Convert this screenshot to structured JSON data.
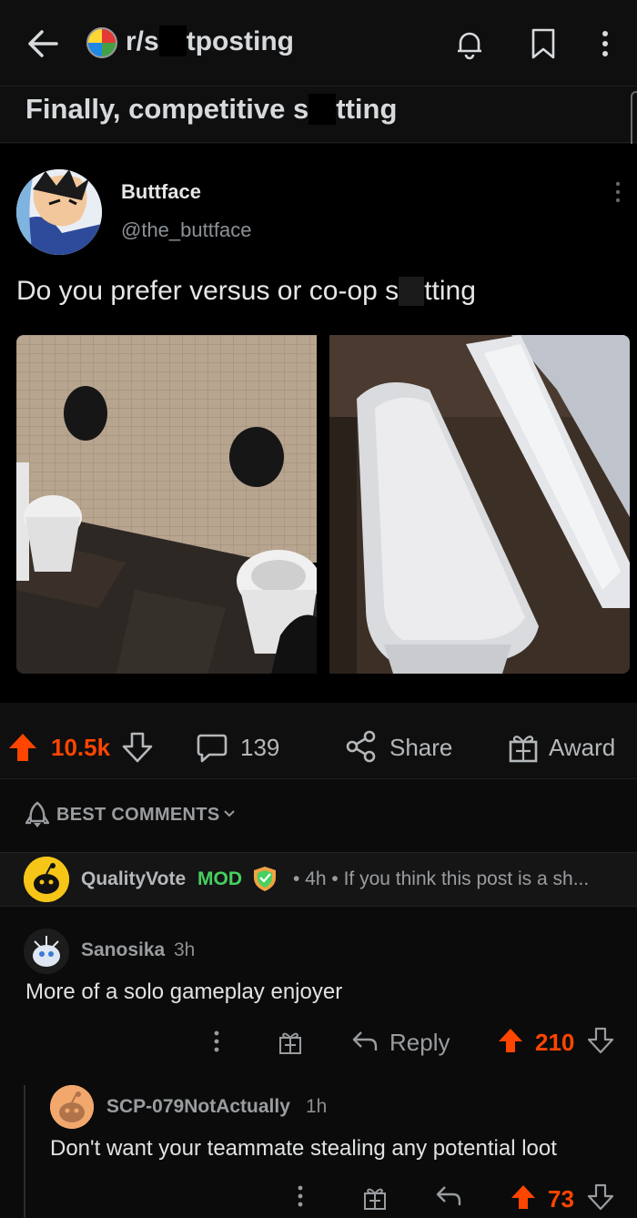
{
  "header": {
    "subreddit_prefix": "r/s",
    "subreddit_suffix": "tposting",
    "icons": [
      "back-arrow-icon",
      "subreddit-avatar",
      "bell-icon",
      "bookmark-icon",
      "kebab-menu-icon"
    ]
  },
  "post": {
    "title_prefix": "Finally, competitive s",
    "title_suffix": "tting"
  },
  "tweet": {
    "name": "Buttface",
    "handle": "@the_buttface",
    "text_prefix": "Do you prefer versus or co-op s",
    "text_suffix": "tting"
  },
  "actions": {
    "votes": "10.5k",
    "comments": "139",
    "share": "Share",
    "award": "Award"
  },
  "sort": {
    "label": "BEST COMMENTS"
  },
  "mod_comment": {
    "user": "QualityVote",
    "badge": "MOD",
    "meta": "• 4h • If you think this post is a sh..."
  },
  "comments": [
    {
      "user": "Sanosika",
      "time": "3h",
      "body": "More of a solo gameplay enjoyer",
      "reply": "Reply",
      "score": "210"
    },
    {
      "user": "SCP-079NotActually",
      "time": "1h",
      "body": "Don't want your teammate stealing any potential loot",
      "score": "73"
    }
  ],
  "colors": {
    "upvote": "#ff4500",
    "mod_green": "#46d160",
    "background": "#0b0b0b"
  }
}
